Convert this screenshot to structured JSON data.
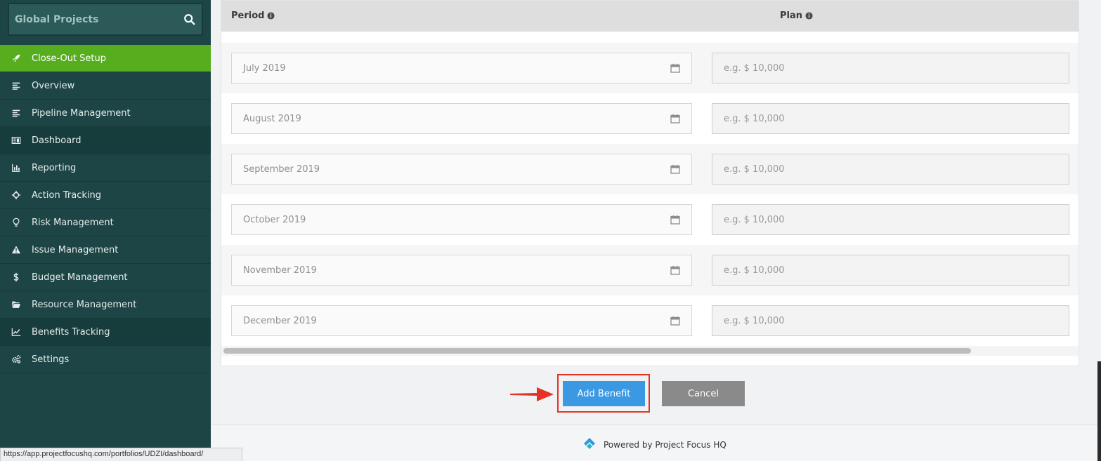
{
  "sidebar": {
    "title": "Global Projects",
    "items": [
      {
        "label": "Close-Out Setup",
        "icon": "rocket-icon",
        "state": "active"
      },
      {
        "label": "Overview",
        "icon": "list-icon",
        "state": ""
      },
      {
        "label": "Pipeline Management",
        "icon": "list-icon",
        "state": ""
      },
      {
        "label": "Dashboard",
        "icon": "dashboard-icon",
        "state": "dark"
      },
      {
        "label": "Reporting",
        "icon": "bar-chart-icon",
        "state": ""
      },
      {
        "label": "Action Tracking",
        "icon": "crosshair-icon",
        "state": ""
      },
      {
        "label": "Risk Management",
        "icon": "lightbulb-icon",
        "state": ""
      },
      {
        "label": "Issue Management",
        "icon": "warning-icon",
        "state": ""
      },
      {
        "label": "Budget Management",
        "icon": "dollar-icon",
        "state": ""
      },
      {
        "label": "Resource Management",
        "icon": "folder-icon",
        "state": ""
      },
      {
        "label": "Benefits Tracking",
        "icon": "line-chart-icon",
        "state": "dark"
      },
      {
        "label": "Settings",
        "icon": "gears-icon",
        "state": ""
      }
    ]
  },
  "table": {
    "period_header": "Period",
    "plan_header": "Plan",
    "rows": [
      {
        "period": "July 2019",
        "plan_placeholder": "e.g. $ 10,000"
      },
      {
        "period": "August 2019",
        "plan_placeholder": "e.g. $ 10,000"
      },
      {
        "period": "September 2019",
        "plan_placeholder": "e.g. $ 10,000"
      },
      {
        "period": "October 2019",
        "plan_placeholder": "e.g. $ 10,000"
      },
      {
        "period": "November 2019",
        "plan_placeholder": "e.g. $ 10,000"
      },
      {
        "period": "December 2019",
        "plan_placeholder": "e.g. $ 10,000"
      }
    ]
  },
  "actions": {
    "add_label": "Add Benefit",
    "cancel_label": "Cancel"
  },
  "footer": {
    "powered_by": "Powered by Project Focus HQ"
  },
  "status_url": "https://app.projectfocushq.com/portfolios/UDZI/dashboard/",
  "colors": {
    "sidebar_bg": "#1d4545",
    "active_item": "#56ae1f",
    "primary_button": "#3b99e4",
    "cancel_button": "#8a8a8a",
    "highlight": "#e53224"
  }
}
